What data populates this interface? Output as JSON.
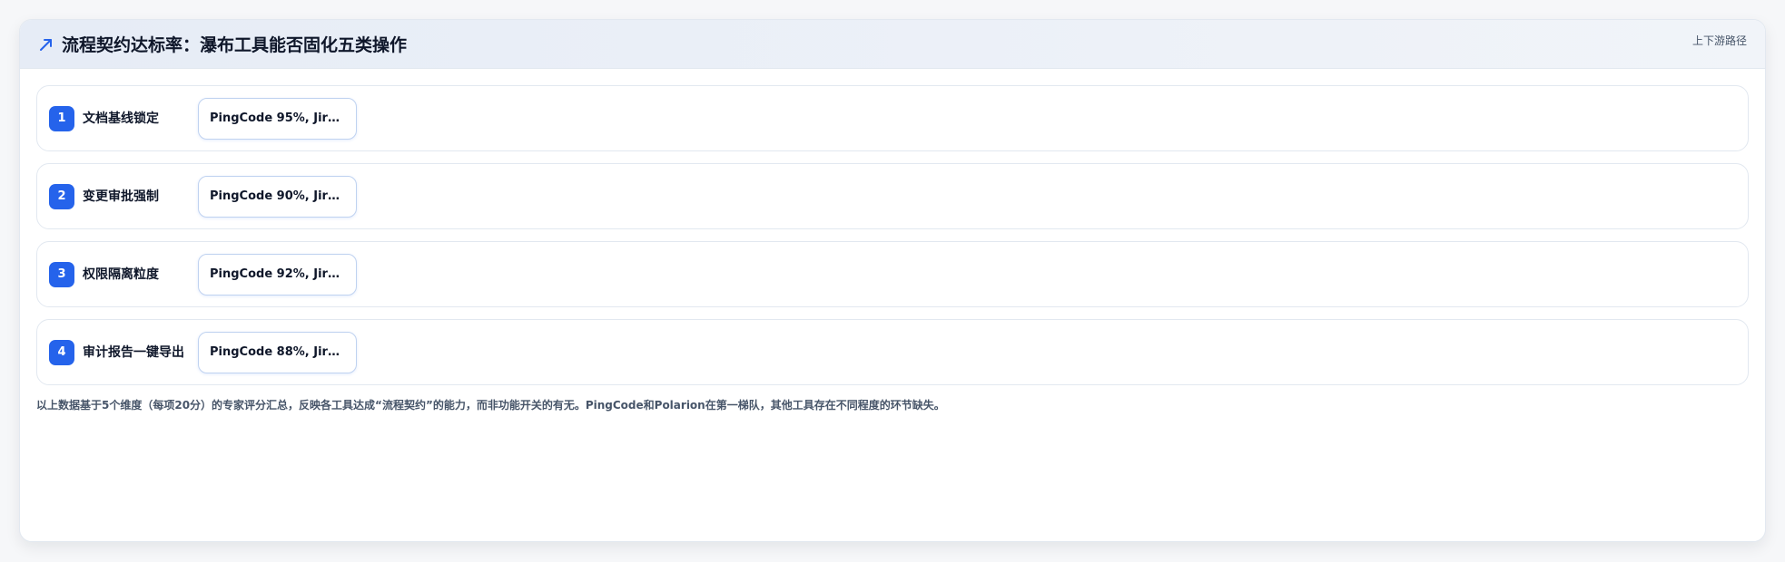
{
  "header": {
    "icon": "trend-up-icon",
    "title": "流程契约达标率：瀑布工具能否固化五类操作",
    "link": "上下游路径"
  },
  "rows": [
    {
      "index": "1",
      "label": "文档基线锁定",
      "score": "PingCode 95%, Jira..."
    },
    {
      "index": "2",
      "label": "变更审批强制",
      "score": "PingCode 90%, Jira..."
    },
    {
      "index": "3",
      "label": "权限隔离粒度",
      "score": "PingCode 92%, Jira..."
    },
    {
      "index": "4",
      "label": "审计报告一键导出",
      "score": "PingCode 88%, Jira..."
    }
  ],
  "footnote": "以上数据基于5个维度（每项20分）的专家评分汇总，反映各工具达成“流程契约”的能力，而非功能开关的有无。PingCode和Polarion在第一梯队，其他工具存在不同程度的环节缺失。",
  "colors": {
    "accent": "#2563eb",
    "border": "#e2e8f0",
    "chip_border": "#bfd2f0"
  }
}
